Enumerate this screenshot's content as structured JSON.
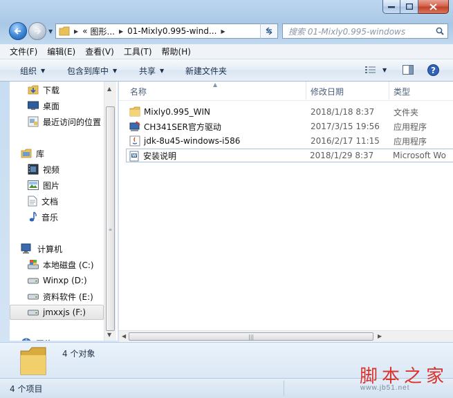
{
  "address": {
    "crumb_prefix": "«",
    "crumb_1": "图形...",
    "crumb_2": "01-Mixly0.995-wind...",
    "search_placeholder": "搜索 01-Mixly0.995-windows"
  },
  "menubar": [
    {
      "label": "文件(F)"
    },
    {
      "label": "编辑(E)"
    },
    {
      "label": "查看(V)"
    },
    {
      "label": "工具(T)"
    },
    {
      "label": "帮助(H)"
    }
  ],
  "toolbar": {
    "organize": "组织",
    "include_library": "包含到库中",
    "share": "共享",
    "new_folder": "新建文件夹"
  },
  "navpane": {
    "downloads": "下载",
    "desktop": "桌面",
    "recent": "最近访问的位置",
    "library": "库",
    "videos": "视频",
    "pictures": "图片",
    "documents": "文档",
    "music": "音乐",
    "computer": "计算机",
    "drive_c": "本地磁盘 (C:)",
    "drive_d": "Winxp (D:)",
    "drive_e": "资料软件 (E:)",
    "drive_f": "jmxxjs (F:)",
    "network": "网络"
  },
  "columns": {
    "name": "名称",
    "date": "修改日期",
    "type": "类型"
  },
  "files": [
    {
      "name": "Mixly0.995_WIN",
      "date": "2018/1/18 8:37",
      "type": "文件夹",
      "icon": "folder-icon"
    },
    {
      "name": "CH341SER官方驱动",
      "date": "2017/3/15 19:56",
      "type": "应用程序",
      "icon": "installer-icon"
    },
    {
      "name": "jdk-8u45-windows-i586",
      "date": "2016/2/17 11:15",
      "type": "应用程序",
      "icon": "java-icon"
    },
    {
      "name": "安装说明",
      "date": "2018/1/29 8:37",
      "type": "Microsoft Wo",
      "icon": "word-document-icon"
    }
  ],
  "details": {
    "count": "4 个对象"
  },
  "status": {
    "text": "4 个项目"
  },
  "watermark": {
    "main": "脚本之家",
    "url": "www.jb51.net"
  },
  "colors": {
    "accent": "#3a85d4",
    "folder": "#e8c15a",
    "watermark": "#d9332b"
  }
}
